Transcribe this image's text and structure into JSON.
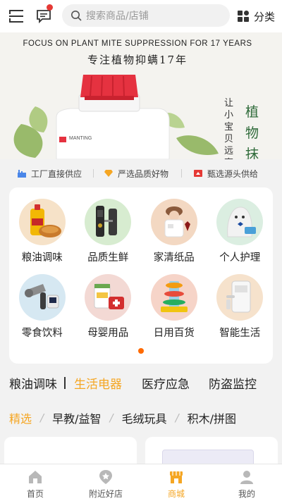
{
  "topbar": {
    "search_placeholder": "搜索商品/店铺",
    "category_label": "分类",
    "icons": [
      "menu-icon",
      "message-icon",
      "search-icon",
      "grid-icon"
    ],
    "badge_color": "#e53935"
  },
  "banner": {
    "headline_en": "FOCUS ON PLANT MITE SUPPRESSION FOR 17 YEARS",
    "headline_cn": "专注植物抑螨17年",
    "product_brand": "MANTING",
    "vertical_text_1": "让小宝贝远离",
    "vertical_text_2": "植物抹"
  },
  "features": [
    {
      "icon": "factory-icon",
      "label": "工厂直接供应"
    },
    {
      "icon": "diamond-icon",
      "label": "严选品质好物"
    },
    {
      "icon": "source-icon",
      "label": "甄选源头供给"
    }
  ],
  "categories": [
    {
      "label": "粮油调味",
      "icon": "grain-oil-icon"
    },
    {
      "label": "品质生鲜",
      "icon": "fresh-food-icon"
    },
    {
      "label": "家清纸品",
      "icon": "household-paper-icon"
    },
    {
      "label": "个人护理",
      "icon": "personal-care-icon"
    },
    {
      "label": "零食饮料",
      "icon": "snacks-drinks-icon"
    },
    {
      "label": "母婴用品",
      "icon": "baby-products-icon"
    },
    {
      "label": "日用百货",
      "icon": "daily-goods-icon"
    },
    {
      "label": "智能生活",
      "icon": "smart-life-icon"
    }
  ],
  "big_tabs": [
    {
      "label": "粮油调味",
      "active": false
    },
    {
      "label": "生活电器",
      "active": true
    },
    {
      "label": "医疗应急",
      "active": false
    },
    {
      "label": "防盗监控",
      "active": false
    }
  ],
  "small_tabs": [
    {
      "label": "精选",
      "active": true
    },
    {
      "label": "早教/益智",
      "active": false
    },
    {
      "label": "毛绒玩具",
      "active": false
    },
    {
      "label": "积木/拼图",
      "active": false
    }
  ],
  "bottom_nav": [
    {
      "label": "首页",
      "icon": "home-icon",
      "active": false
    },
    {
      "label": "附近好店",
      "icon": "nearby-store-icon",
      "active": false
    },
    {
      "label": "商城",
      "icon": "mall-icon",
      "active": true
    },
    {
      "label": "我的",
      "icon": "profile-icon",
      "active": false
    }
  ],
  "colors": {
    "accent": "#f5a623",
    "indicator": "#ff6a00",
    "background": "#f2f2f2",
    "card": "#ffffff"
  }
}
